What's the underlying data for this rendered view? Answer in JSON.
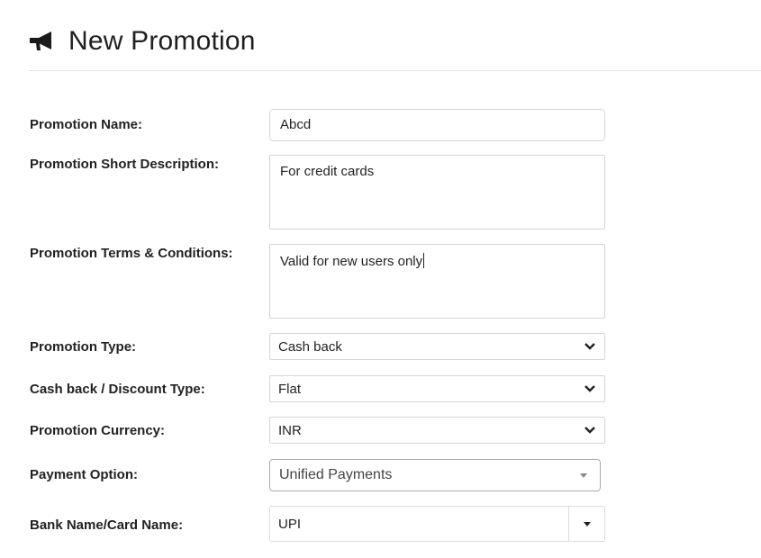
{
  "page": {
    "title": "New Promotion",
    "icon": "megaphone-icon"
  },
  "form": {
    "promotion_name": {
      "label": "Promotion Name:",
      "value": "Abcd"
    },
    "short_description": {
      "label": "Promotion Short Description:",
      "value": "For credit cards"
    },
    "terms_conditions": {
      "label": "Promotion Terms & Conditions:",
      "value": "Valid for new users only"
    },
    "promotion_type": {
      "label": "Promotion Type:",
      "value": "Cash back"
    },
    "discount_type": {
      "label": "Cash back / Discount Type:",
      "value": "Flat"
    },
    "currency": {
      "label": "Promotion Currency:",
      "value": "INR"
    },
    "payment_option": {
      "label": "Payment Option:",
      "value": "Unified Payments"
    },
    "bank_card_name": {
      "label": "Bank Name/Card Name:",
      "value": "UPI"
    }
  }
}
